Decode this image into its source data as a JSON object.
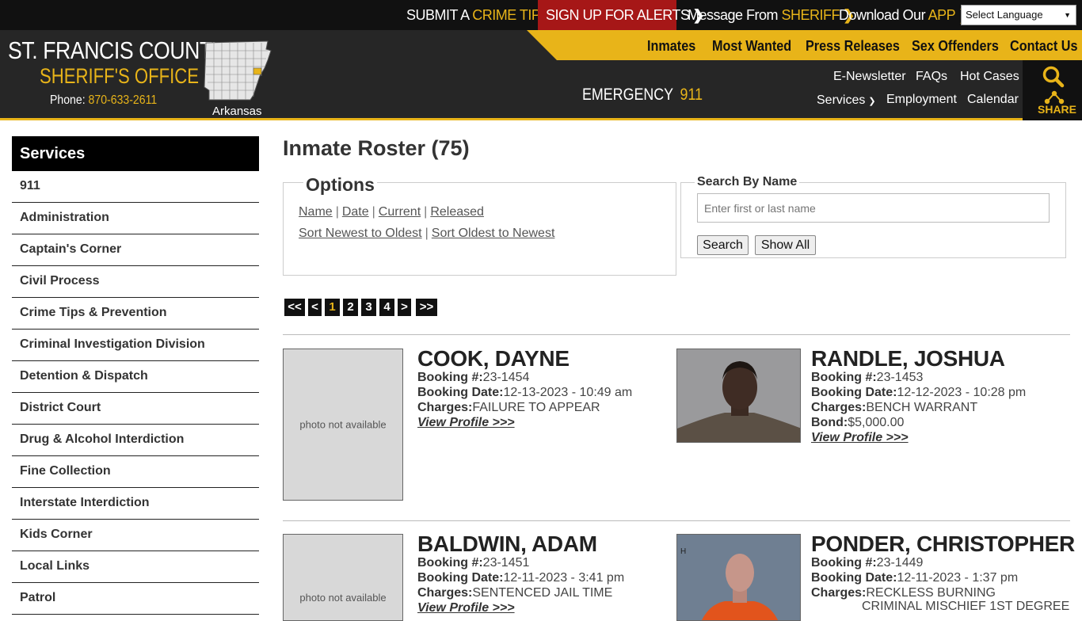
{
  "topbar": {
    "crime_tip_prefix": "SUBMIT A ",
    "crime_tip_hl": "CRIME TIP",
    "alerts": "SIGN UP FOR ALERTS",
    "sheriff_prefix": "Message From ",
    "sheriff_hl": "SHERIFF",
    "app_prefix": "Download Our ",
    "app_hl": "APP",
    "language": "Select Language"
  },
  "logo": {
    "title": "ST. FRANCIS COUNTY",
    "subtitle": "SHERIFF'S OFFICE",
    "phone_label": "Phone:",
    "phone_number": "870-633-2611",
    "state": "Arkansas"
  },
  "primary_nav": [
    "Inmates",
    "Most Wanted",
    "Press Releases",
    "Sex Offenders",
    "Contact Us"
  ],
  "emergency": {
    "label": "EMERGENCY",
    "number": "911"
  },
  "secondary_nav": {
    "enewsletter": "E-Newsletter",
    "faqs": "FAQs",
    "hot_cases": "Hot Cases",
    "services": "Services",
    "employment": "Employment",
    "calendar": "Calendar"
  },
  "share_label": "SHARE",
  "sidebar": {
    "title": "Services",
    "items": [
      "911",
      "Administration",
      "Captain's Corner",
      "Civil Process",
      "Crime Tips & Prevention",
      "Criminal Investigation Division",
      "Detention & Dispatch",
      "District Court",
      "Drug & Alcohol Interdiction",
      "Fine Collection",
      "Interstate Interdiction",
      "Kids Corner",
      "Local Links",
      "Patrol"
    ]
  },
  "page_title": "Inmate Roster (75)",
  "options": {
    "legend": "Options",
    "sort_fields": [
      "Name",
      "Date",
      "Current",
      "Released"
    ],
    "sort_orders": [
      "Sort Newest to Oldest",
      "Sort Oldest to Newest"
    ]
  },
  "search": {
    "legend": "Search By Name",
    "placeholder": "Enter first or last name",
    "search_button": "Search",
    "show_all_button": "Show All"
  },
  "pagination": {
    "first": "<<",
    "prev": "<",
    "pages": [
      "1",
      "2",
      "3",
      "4"
    ],
    "current": "1",
    "next": ">",
    "last": ">>"
  },
  "labels": {
    "booking": "Booking #:",
    "booking_date": "Booking Date:",
    "charges": "Charges:",
    "bond": "Bond:",
    "view_profile": "View Profile >>>",
    "photo_na": "photo not available"
  },
  "inmates": [
    {
      "name": "COOK, DAYNE",
      "booking": "23-1454",
      "date": "12-13-2023 - 10:49 am",
      "charges": "FAILURE TO APPEAR",
      "bond": "",
      "photo": false
    },
    {
      "name": "RANDLE, JOSHUA",
      "booking": "23-1453",
      "date": "12-12-2023 - 10:28 pm",
      "charges": "BENCH WARRANT",
      "bond": "$5,000.00",
      "photo": true
    },
    {
      "name": "BALDWIN, ADAM",
      "booking": "23-1451",
      "date": "12-11-2023 - 3:41 pm",
      "charges": "SENTENCED JAIL TIME",
      "bond": "",
      "photo": false
    },
    {
      "name": "PONDER, CHRISTOPHER",
      "booking": "23-1449",
      "date": "12-11-2023 - 1:37 pm",
      "charges": "RECKLESS BURNING",
      "charges2": "CRIMINAL MISCHIEF 1ST DEGREE",
      "bond": "",
      "photo": true
    }
  ],
  "colors": {
    "accent": "#e8b419",
    "alert_red": "#a61717",
    "header_bg": "#262626",
    "topbar_bg": "#111111"
  }
}
